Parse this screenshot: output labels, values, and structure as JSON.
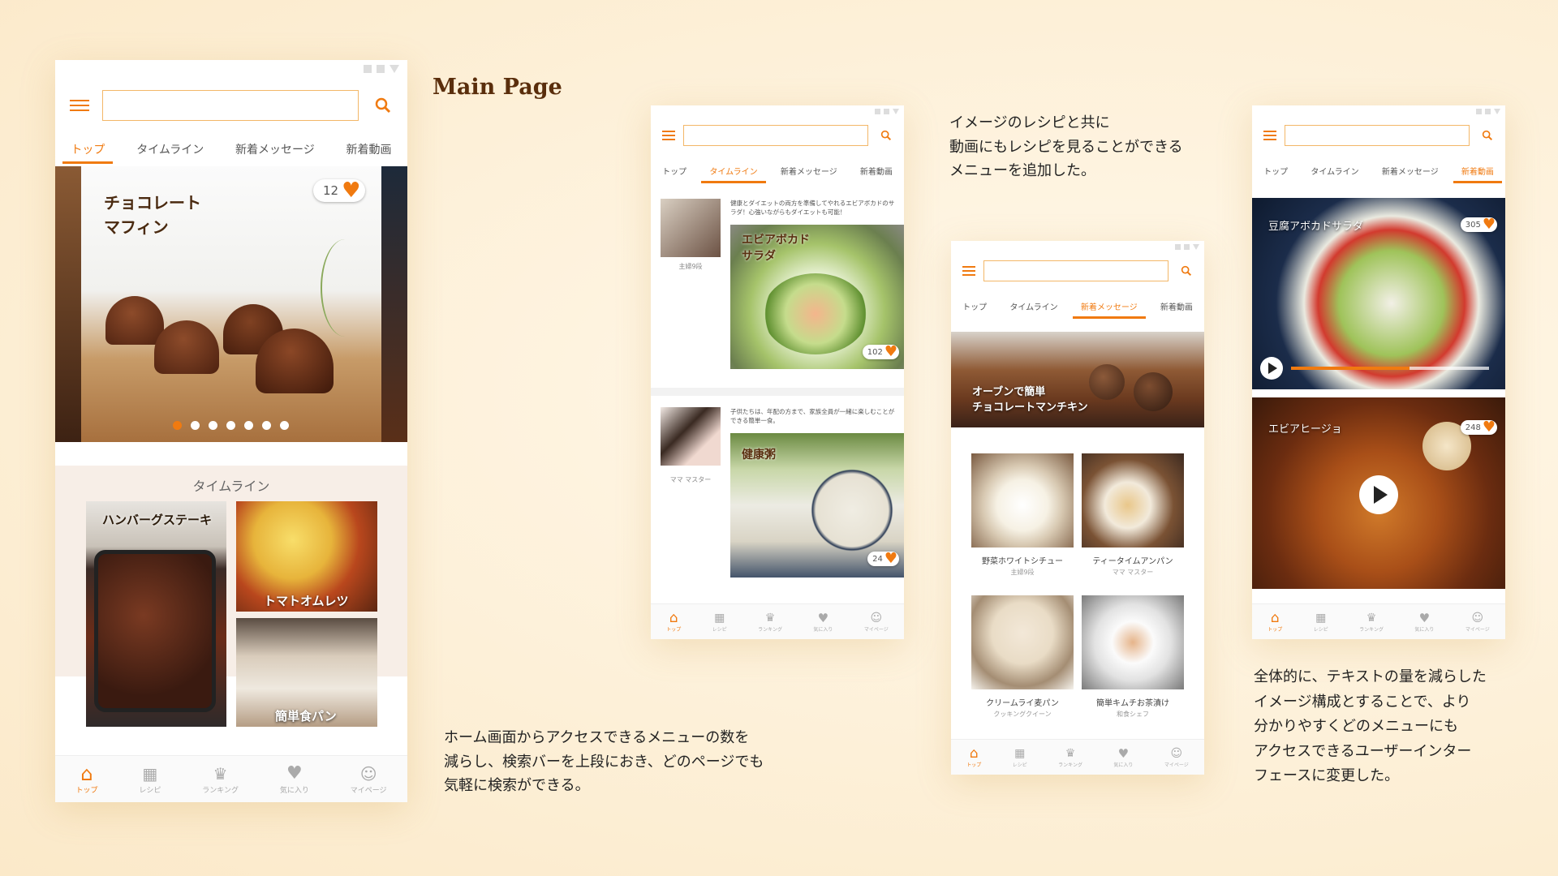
{
  "title": "Main Page",
  "notes": {
    "menu": "ホーム画面からアクセスできるメニューの数を\n減らし、検索バーを上段におき、どのページでも\n気軽に検索ができる。",
    "video": "イメージのレシピと共に\n動画にもレシピを見ることができる\nメニューを追加した。",
    "overall": "全体的に、テキストの量を減らした\nイメージ構成とすることで、より\n分かりやすくどのメニューにも\nアクセスできるユーザーインター\nフェースに変更した。"
  },
  "tabs": [
    "トップ",
    "タイムライン",
    "新着メッセージ",
    "新着動画"
  ],
  "nav": [
    "トップ",
    "レシピ",
    "ランキング",
    "気に入り",
    "マイページ"
  ],
  "colors": {
    "accent": "#f07a10",
    "background": "#fdf0d8"
  },
  "main": {
    "hero_title": "チョコレート\nマフィン",
    "hero_likes": "12",
    "section_title": "タイムライン",
    "cards": [
      "ハンバーグステーキ",
      "トマトオムレツ",
      "簡単食パン"
    ]
  },
  "timeline": {
    "posts": [
      {
        "author": "主婦9段",
        "text": "健康とダイエットの両方を準備してやれるエビアボカドのサラダ！心強いながらもダイエットも可能！",
        "title": "エビアボカド\nサラダ",
        "likes": "102"
      },
      {
        "author": "ママ マスター",
        "text": "子供たちは、年配の方まで、家族全員が一緒に楽しむことができる簡単一食。",
        "title": "健康粥",
        "likes": "24"
      }
    ]
  },
  "messages": {
    "banner": "オーブンで簡単\nチョコレートマンチキン",
    "items": [
      {
        "title": "野菜ホワイトシチュー",
        "author": "主婦9段"
      },
      {
        "title": "ティータイムアンパン",
        "author": "ママ マスター"
      },
      {
        "title": "クリームライ麦パン",
        "author": "クッキングクイーン"
      },
      {
        "title": "簡単キムチお茶漬け",
        "author": "和食シェフ"
      }
    ]
  },
  "videos": {
    "items": [
      {
        "title": "豆腐アボカドサラダ",
        "likes": "305"
      },
      {
        "title": "エビアヒージョ",
        "likes": "248"
      }
    ]
  }
}
